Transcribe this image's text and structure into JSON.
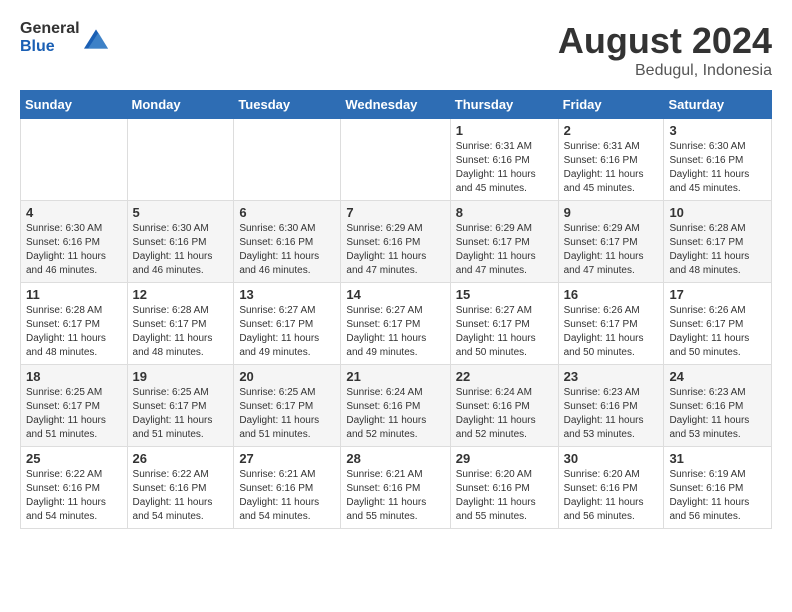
{
  "header": {
    "logo_general": "General",
    "logo_blue": "Blue",
    "title": "August 2024",
    "location": "Bedugul, Indonesia"
  },
  "columns": [
    "Sunday",
    "Monday",
    "Tuesday",
    "Wednesday",
    "Thursday",
    "Friday",
    "Saturday"
  ],
  "weeks": [
    {
      "days": [
        {
          "number": "",
          "info": ""
        },
        {
          "number": "",
          "info": ""
        },
        {
          "number": "",
          "info": ""
        },
        {
          "number": "",
          "info": ""
        },
        {
          "number": "1",
          "info": "Sunrise: 6:31 AM\nSunset: 6:16 PM\nDaylight: 11 hours and 45 minutes."
        },
        {
          "number": "2",
          "info": "Sunrise: 6:31 AM\nSunset: 6:16 PM\nDaylight: 11 hours and 45 minutes."
        },
        {
          "number": "3",
          "info": "Sunrise: 6:30 AM\nSunset: 6:16 PM\nDaylight: 11 hours and 45 minutes."
        }
      ]
    },
    {
      "days": [
        {
          "number": "4",
          "info": "Sunrise: 6:30 AM\nSunset: 6:16 PM\nDaylight: 11 hours and 46 minutes."
        },
        {
          "number": "5",
          "info": "Sunrise: 6:30 AM\nSunset: 6:16 PM\nDaylight: 11 hours and 46 minutes."
        },
        {
          "number": "6",
          "info": "Sunrise: 6:30 AM\nSunset: 6:16 PM\nDaylight: 11 hours and 46 minutes."
        },
        {
          "number": "7",
          "info": "Sunrise: 6:29 AM\nSunset: 6:16 PM\nDaylight: 11 hours and 47 minutes."
        },
        {
          "number": "8",
          "info": "Sunrise: 6:29 AM\nSunset: 6:17 PM\nDaylight: 11 hours and 47 minutes."
        },
        {
          "number": "9",
          "info": "Sunrise: 6:29 AM\nSunset: 6:17 PM\nDaylight: 11 hours and 47 minutes."
        },
        {
          "number": "10",
          "info": "Sunrise: 6:28 AM\nSunset: 6:17 PM\nDaylight: 11 hours and 48 minutes."
        }
      ]
    },
    {
      "days": [
        {
          "number": "11",
          "info": "Sunrise: 6:28 AM\nSunset: 6:17 PM\nDaylight: 11 hours and 48 minutes."
        },
        {
          "number": "12",
          "info": "Sunrise: 6:28 AM\nSunset: 6:17 PM\nDaylight: 11 hours and 48 minutes."
        },
        {
          "number": "13",
          "info": "Sunrise: 6:27 AM\nSunset: 6:17 PM\nDaylight: 11 hours and 49 minutes."
        },
        {
          "number": "14",
          "info": "Sunrise: 6:27 AM\nSunset: 6:17 PM\nDaylight: 11 hours and 49 minutes."
        },
        {
          "number": "15",
          "info": "Sunrise: 6:27 AM\nSunset: 6:17 PM\nDaylight: 11 hours and 50 minutes."
        },
        {
          "number": "16",
          "info": "Sunrise: 6:26 AM\nSunset: 6:17 PM\nDaylight: 11 hours and 50 minutes."
        },
        {
          "number": "17",
          "info": "Sunrise: 6:26 AM\nSunset: 6:17 PM\nDaylight: 11 hours and 50 minutes."
        }
      ]
    },
    {
      "days": [
        {
          "number": "18",
          "info": "Sunrise: 6:25 AM\nSunset: 6:17 PM\nDaylight: 11 hours and 51 minutes."
        },
        {
          "number": "19",
          "info": "Sunrise: 6:25 AM\nSunset: 6:17 PM\nDaylight: 11 hours and 51 minutes."
        },
        {
          "number": "20",
          "info": "Sunrise: 6:25 AM\nSunset: 6:17 PM\nDaylight: 11 hours and 51 minutes."
        },
        {
          "number": "21",
          "info": "Sunrise: 6:24 AM\nSunset: 6:16 PM\nDaylight: 11 hours and 52 minutes."
        },
        {
          "number": "22",
          "info": "Sunrise: 6:24 AM\nSunset: 6:16 PM\nDaylight: 11 hours and 52 minutes."
        },
        {
          "number": "23",
          "info": "Sunrise: 6:23 AM\nSunset: 6:16 PM\nDaylight: 11 hours and 53 minutes."
        },
        {
          "number": "24",
          "info": "Sunrise: 6:23 AM\nSunset: 6:16 PM\nDaylight: 11 hours and 53 minutes."
        }
      ]
    },
    {
      "days": [
        {
          "number": "25",
          "info": "Sunrise: 6:22 AM\nSunset: 6:16 PM\nDaylight: 11 hours and 54 minutes."
        },
        {
          "number": "26",
          "info": "Sunrise: 6:22 AM\nSunset: 6:16 PM\nDaylight: 11 hours and 54 minutes."
        },
        {
          "number": "27",
          "info": "Sunrise: 6:21 AM\nSunset: 6:16 PM\nDaylight: 11 hours and 54 minutes."
        },
        {
          "number": "28",
          "info": "Sunrise: 6:21 AM\nSunset: 6:16 PM\nDaylight: 11 hours and 55 minutes."
        },
        {
          "number": "29",
          "info": "Sunrise: 6:20 AM\nSunset: 6:16 PM\nDaylight: 11 hours and 55 minutes."
        },
        {
          "number": "30",
          "info": "Sunrise: 6:20 AM\nSunset: 6:16 PM\nDaylight: 11 hours and 56 minutes."
        },
        {
          "number": "31",
          "info": "Sunrise: 6:19 AM\nSunset: 6:16 PM\nDaylight: 11 hours and 56 minutes."
        }
      ]
    }
  ]
}
